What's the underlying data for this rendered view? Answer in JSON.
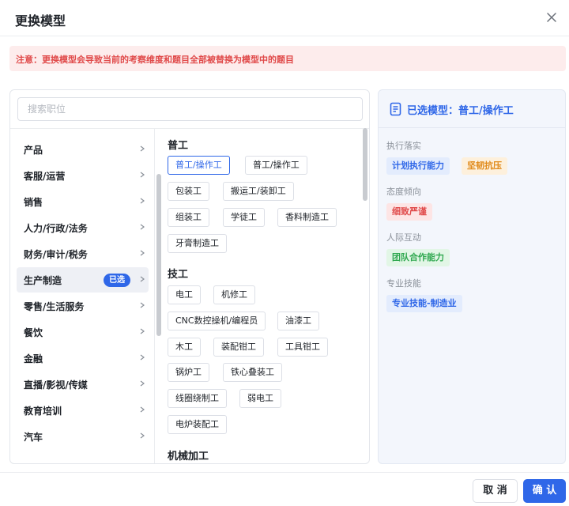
{
  "dialog": {
    "title": "更换模型"
  },
  "warning": "注意：更换模型会导致当前的考察维度和题目全部被替换为模型中的题目",
  "search": {
    "placeholder": "搜索职位"
  },
  "categories": [
    {
      "label": "产品"
    },
    {
      "label": "客服/运营"
    },
    {
      "label": "销售"
    },
    {
      "label": "人力/行政/法务"
    },
    {
      "label": "财务/审计/税务"
    },
    {
      "label": "生产制造",
      "badge": "已选",
      "active": true
    },
    {
      "label": "零售/生活服务"
    },
    {
      "label": "餐饮"
    },
    {
      "label": "金融"
    },
    {
      "label": "直播/影视/传媒"
    },
    {
      "label": "教育培训"
    },
    {
      "label": "汽车"
    }
  ],
  "job_groups": [
    {
      "title": "普工",
      "jobs": [
        "普工/操作工",
        "普工/操作工",
        "包装工",
        "搬运工/装卸工",
        "组装工",
        "学徒工",
        "香料制造工",
        "牙膏制造工"
      ],
      "selected_index": 0
    },
    {
      "title": "技工",
      "jobs": [
        "电工",
        "机修工",
        "CNC数控操机/编程员",
        "油漆工",
        "木工",
        "装配钳工",
        "工具钳工",
        "锅炉工",
        "铁心叠装工",
        "线圈绕制工",
        "弱电工",
        "电炉装配工"
      ]
    },
    {
      "title": "机械加工",
      "jobs": []
    }
  ],
  "selected_model": {
    "title": "已选模型：普工/操作工",
    "sections": [
      {
        "name": "执行落实",
        "tags": [
          {
            "label": "计划执行能力",
            "color": "blue"
          },
          {
            "label": "坚韧抗压",
            "color": "orange"
          }
        ]
      },
      {
        "name": "态度倾向",
        "tags": [
          {
            "label": "细致严谨",
            "color": "red"
          }
        ]
      },
      {
        "name": "人际互动",
        "tags": [
          {
            "label": "团队合作能力",
            "color": "green"
          }
        ]
      },
      {
        "name": "专业技能",
        "tags": [
          {
            "label": "专业技能-制造业",
            "color": "blue"
          }
        ]
      }
    ]
  },
  "footer": {
    "cancel": "取 消",
    "confirm": "确 认"
  },
  "colors": {
    "accent": "#2f67e8",
    "warning_bg": "#fdecec",
    "warning_text": "#e04a4a"
  }
}
